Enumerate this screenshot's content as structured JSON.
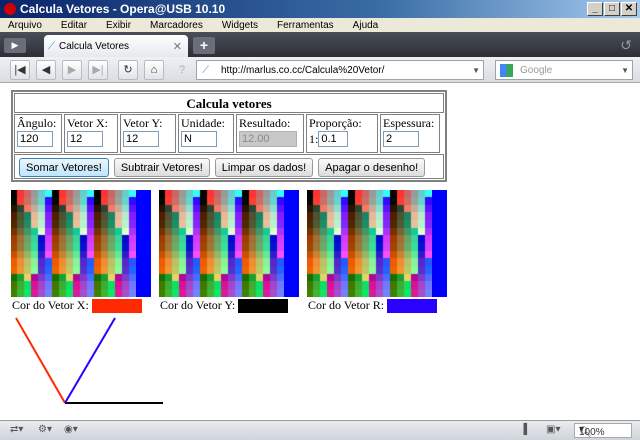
{
  "window": {
    "title": "Calcula Vetores - Opera@USB 10.10"
  },
  "menu": [
    "Arquivo",
    "Editar",
    "Exibir",
    "Marcadores",
    "Widgets",
    "Ferramentas",
    "Ajuda"
  ],
  "tab": {
    "label": "Calcula Vetores"
  },
  "address": {
    "url": "http://marlus.co.cc/Calcula%20Vetor/"
  },
  "search": {
    "placeholder": "Google"
  },
  "form": {
    "title": "Calcula vetores",
    "fields": [
      {
        "label": "Ângulo:",
        "value": "120"
      },
      {
        "label": "Vetor X:",
        "value": "12"
      },
      {
        "label": "Vetor Y:",
        "value": "12"
      },
      {
        "label": "Unidade:",
        "value": "N"
      },
      {
        "label": "Resultado:",
        "value": "12.00"
      },
      {
        "label": "Proporção:",
        "prefix": "1:",
        "value": "0.1"
      },
      {
        "label": "Espessura:",
        "value": "2"
      }
    ],
    "buttons": [
      "Somar Vetores!",
      "Subtrair Vetores!",
      "Limpar os dados!",
      "Apagar o desenho!"
    ]
  },
  "colors": {
    "labels": [
      "Cor do Vetor X:",
      "Cor do Vetor Y:",
      "Cor do Vetor R:"
    ],
    "values": [
      "#ff2a00",
      "#000000",
      "#2a00ff"
    ]
  },
  "status": {
    "zoom": "100%"
  }
}
